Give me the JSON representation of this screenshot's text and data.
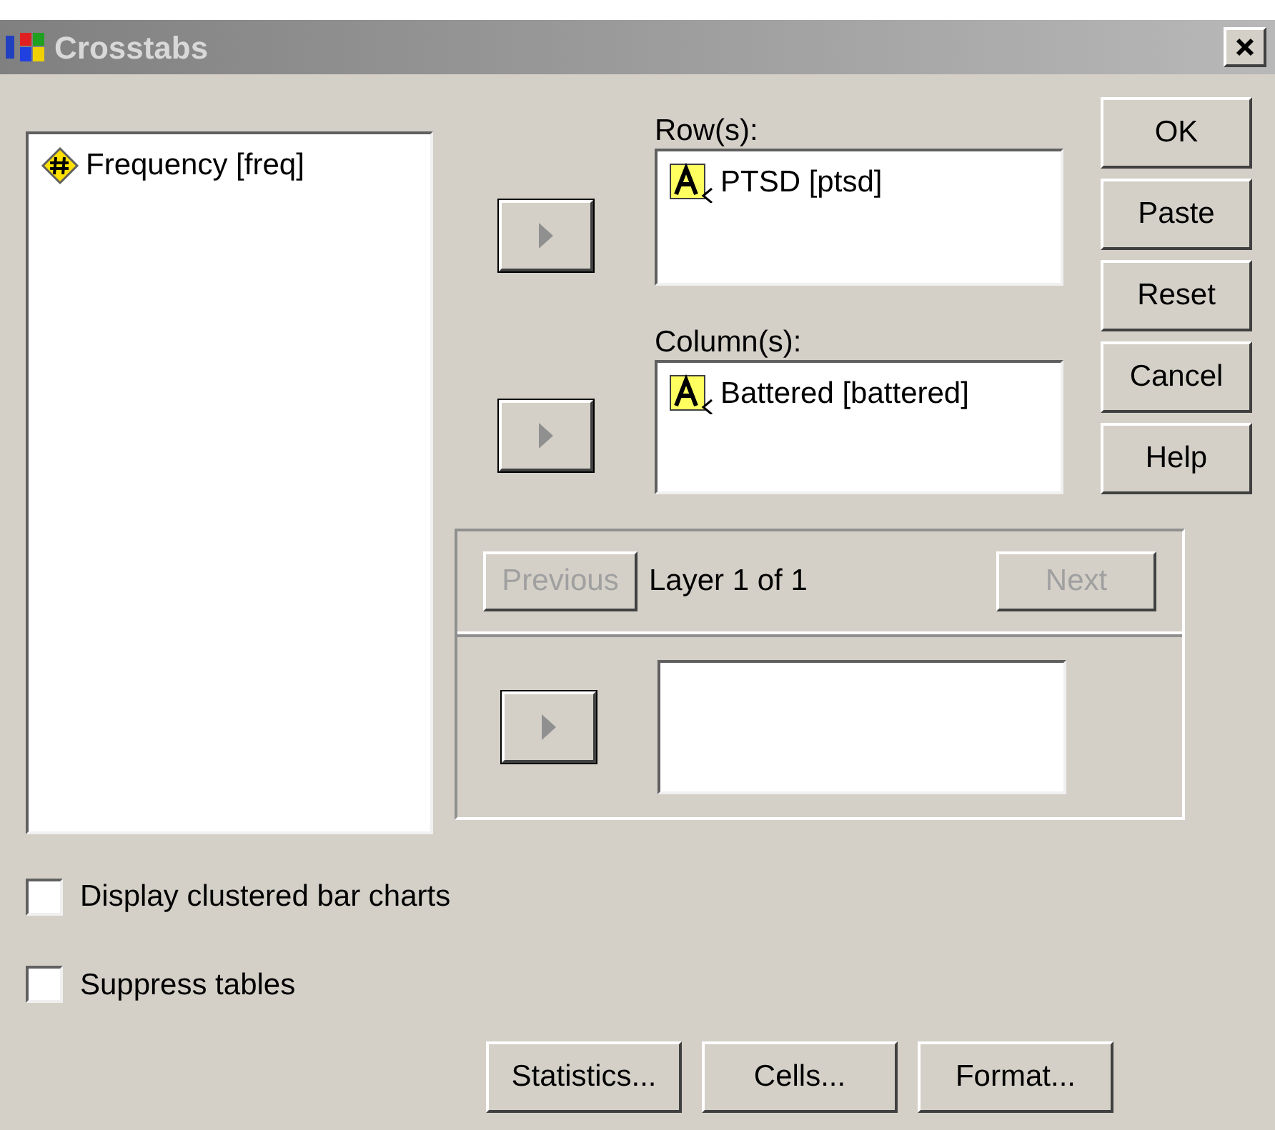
{
  "window": {
    "title": "Crosstabs"
  },
  "source_list": {
    "items": [
      {
        "label": "Frequency [freq]",
        "kind": "scale"
      }
    ]
  },
  "rows": {
    "label": "Row(s):",
    "items": [
      {
        "label": "PTSD [ptsd]",
        "kind": "nominal"
      }
    ]
  },
  "columns": {
    "label": "Column(s):",
    "items": [
      {
        "label": "Battered [battered]",
        "kind": "nominal"
      }
    ]
  },
  "layer": {
    "previous": {
      "label": "Previous",
      "disabled": true
    },
    "text": "Layer 1 of 1",
    "next": {
      "label": "Next",
      "disabled": true
    }
  },
  "side_buttons": [
    "OK",
    "Paste",
    "Reset",
    "Cancel",
    "Help"
  ],
  "options": [
    {
      "label": "Display clustered bar charts",
      "checked": false
    },
    {
      "label": "Suppress tables",
      "checked": false
    }
  ],
  "bottom_buttons": [
    "Statistics...",
    "Cells...",
    "Format..."
  ]
}
